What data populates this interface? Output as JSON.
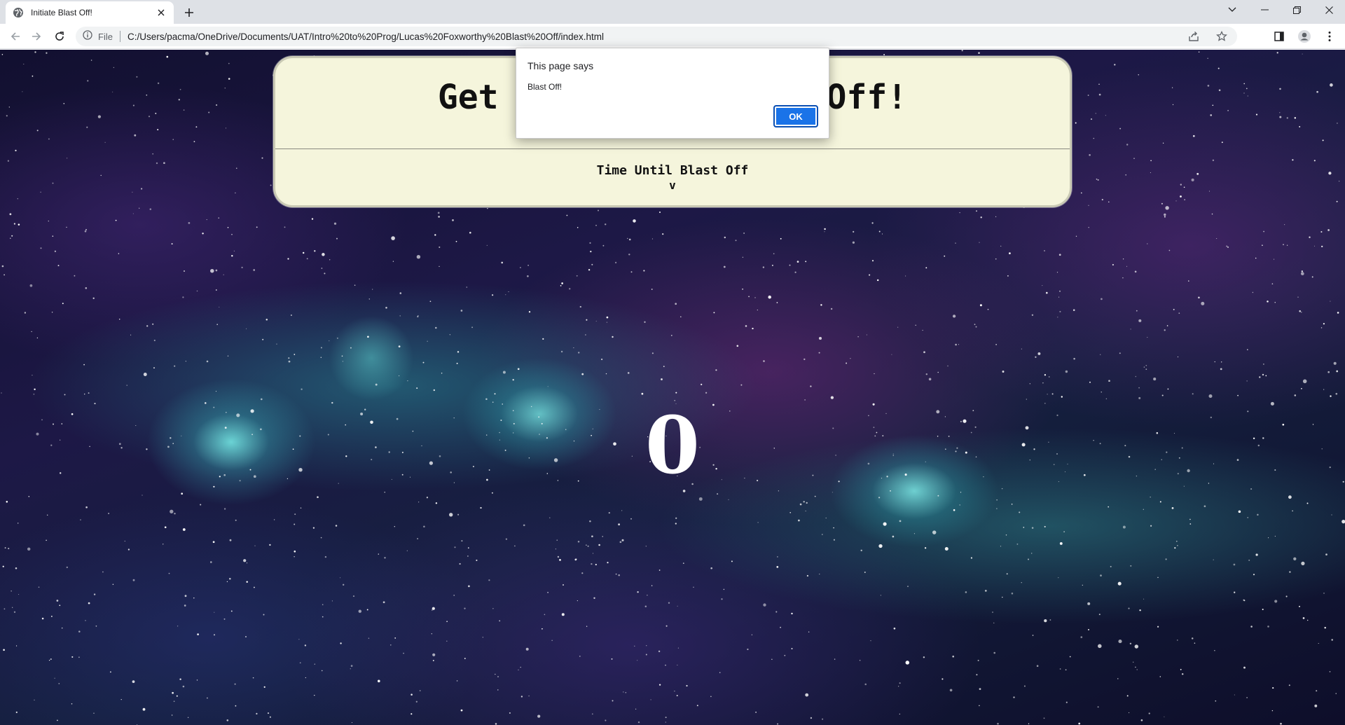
{
  "browser": {
    "tab": {
      "title": "Initiate Blast Off!",
      "favicon": "globe-icon"
    },
    "address_bar": {
      "scheme_label": "File",
      "url": "C:/Users/pacma/OneDrive/Documents/UAT/Intro%20to%20Prog/Lucas%20Foxworthy%20Blast%20Off/index.html"
    },
    "icons": {
      "back": "arrow-left-icon",
      "forward": "arrow-right-icon",
      "reload": "reload-icon",
      "site_info": "info-icon",
      "share": "share-icon",
      "bookmark": "star-icon",
      "side_panel": "side-panel-icon",
      "profile": "profile-icon",
      "menu": "kebab-menu-icon",
      "tab_search": "chevron-down-icon",
      "minimize": "minimize-icon",
      "restore": "restore-icon",
      "close": "close-icon"
    }
  },
  "page": {
    "header_visible_left": "Get",
    "header_visible_right": "Off!",
    "subheading": "Time Until Blast Off",
    "arrow_text": "v",
    "countdown": "0"
  },
  "dialog": {
    "title": "This page says",
    "message": "Blast Off!",
    "ok_label": "OK"
  },
  "colors": {
    "panel_bg": "#f5f5dc",
    "ok_button": "#1a73e8",
    "tabstrip": "#dee1e6",
    "omnibox": "#f1f3f4"
  }
}
